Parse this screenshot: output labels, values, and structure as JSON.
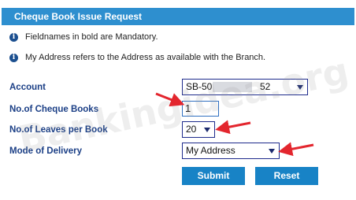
{
  "title": "Cheque Book Issue Request",
  "info": [
    "Fieldnames in bold are Mandatory.",
    "My Address refers to the Address as available with the Branch."
  ],
  "form": {
    "account": {
      "label": "Account",
      "prefix": "SB-50",
      "suffix": "52"
    },
    "cheque_books": {
      "label": "No.of Cheque Books",
      "value": "1"
    },
    "leaves": {
      "label": "No.of Leaves per Book",
      "value": "20"
    },
    "delivery": {
      "label": "Mode of Delivery",
      "value": "My Address"
    }
  },
  "buttons": {
    "submit": "Submit",
    "reset": "Reset"
  },
  "watermark": "Bankingidea.org",
  "icons": {
    "info": "info-icon",
    "dropdown": "chevron-down-icon"
  },
  "colors": {
    "accent": "#2e8fcf",
    "label": "#1b3f86",
    "button": "#1883c6",
    "annotation_arrow": "#e3262e"
  }
}
